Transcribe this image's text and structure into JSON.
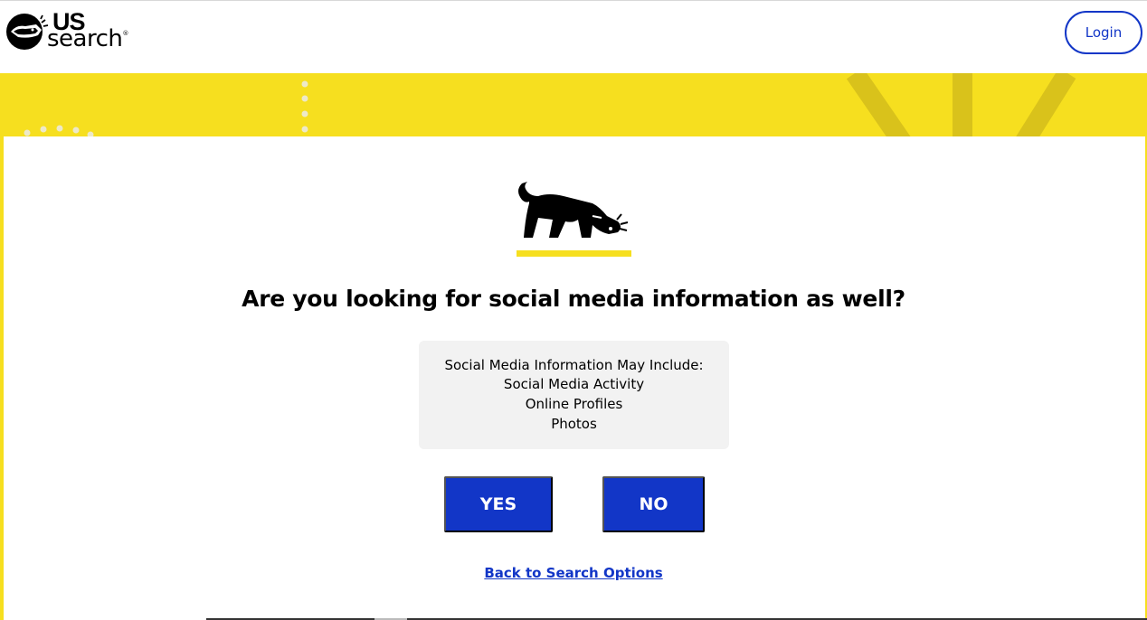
{
  "header": {
    "logo": {
      "line1": "US",
      "line2": "search",
      "trademark": "®",
      "icon": "dog-head-icon"
    },
    "login_label": "Login"
  },
  "colors": {
    "brand_yellow": "#f6df1f",
    "brand_blue": "#1236c7"
  },
  "modal": {
    "illustration_icon": "sniffing-dog-icon",
    "question": "Are you looking for social media information as well?",
    "info": {
      "title": "Social Media Information May Include:",
      "items": [
        "Social Media Activity",
        "Online Profiles",
        "Photos"
      ]
    },
    "yes_label": "YES",
    "no_label": "NO",
    "back_link": "Back to Search Options"
  }
}
